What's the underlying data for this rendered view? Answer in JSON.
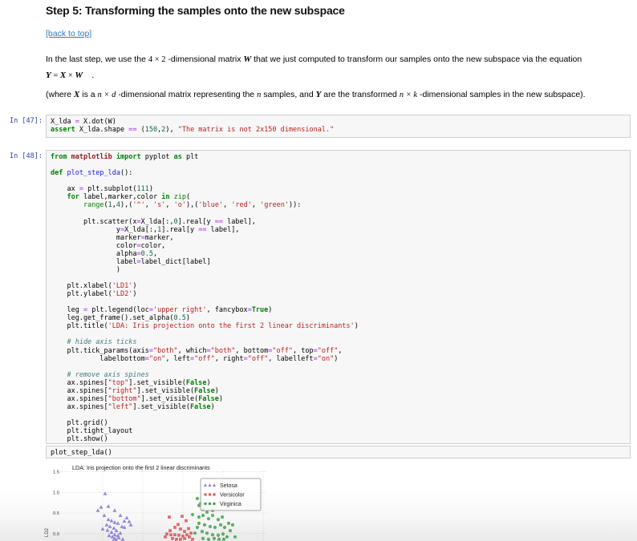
{
  "page": {
    "heading": "Step 5: Transforming the samples onto the new subspace",
    "back_link": "[back to top]",
    "para1": [
      {
        "t": "t",
        "v": "In the last step, we use the "
      },
      {
        "t": "m",
        "v": "4 × 2"
      },
      {
        "t": "t",
        "v": " -dimensional matrix "
      },
      {
        "t": "mb",
        "v": "W"
      },
      {
        "t": "t",
        "v": " that we just computed to transform our samples onto the new subspace via the equation"
      }
    ],
    "equation": [
      {
        "t": "mb",
        "v": "Y"
      },
      {
        "t": "m",
        "v": " = "
      },
      {
        "t": "mb",
        "v": "X"
      },
      {
        "t": "m",
        "v": " × "
      },
      {
        "t": "mb",
        "v": "W"
      },
      {
        "t": "t",
        "v": "  ."
      }
    ],
    "para2": [
      {
        "t": "t",
        "v": "(where "
      },
      {
        "t": "mb",
        "v": "X"
      },
      {
        "t": "t",
        "v": " is a "
      },
      {
        "t": "mi",
        "v": "n × d"
      },
      {
        "t": "t",
        "v": " -dimensional matrix representing the "
      },
      {
        "t": "mi",
        "v": "n"
      },
      {
        "t": "t",
        "v": " samples, and "
      },
      {
        "t": "mb",
        "v": "Y"
      },
      {
        "t": "t",
        "v": " are the transformed "
      },
      {
        "t": "mi",
        "v": "n × k"
      },
      {
        "t": "t",
        "v": " -dimensional samples in the new subspace)."
      }
    ]
  },
  "cells": [
    {
      "prompt": "In [47]:",
      "lines": [
        [
          [
            "p",
            "X_lda "
          ],
          [
            "o",
            "="
          ],
          [
            "p",
            " X.dot(W)"
          ]
        ],
        [
          [
            "k",
            "assert"
          ],
          [
            "p",
            " X_lda.shape "
          ],
          [
            "o",
            "=="
          ],
          [
            "p",
            " ("
          ],
          [
            "m",
            "150"
          ],
          [
            "p",
            ","
          ],
          [
            "m",
            "2"
          ],
          [
            "p",
            "), "
          ],
          [
            "s",
            "\"The matrix is not 2x150 dimensional.\""
          ]
        ]
      ]
    },
    {
      "prompt": "In [48]:",
      "lines": [
        [
          [
            "k",
            "from"
          ],
          [
            "nn",
            " matplotlib "
          ],
          [
            "k",
            "import"
          ],
          [
            "p",
            " pyplot "
          ],
          [
            "k",
            "as"
          ],
          [
            "p",
            " plt"
          ]
        ],
        [],
        [
          [
            "k",
            "def"
          ],
          [
            "fn",
            " plot_step_lda"
          ],
          [
            "p",
            "():"
          ]
        ],
        [],
        [
          [
            "p",
            "    ax "
          ],
          [
            "o",
            "="
          ],
          [
            "p",
            " plt.subplot("
          ],
          [
            "m",
            "111"
          ],
          [
            "p",
            ")"
          ]
        ],
        [
          [
            "p",
            "    "
          ],
          [
            "k",
            "for"
          ],
          [
            "p",
            " label,marker,color "
          ],
          [
            "k",
            "in"
          ],
          [
            "p",
            " "
          ],
          [
            "b",
            "zip"
          ],
          [
            "p",
            "("
          ]
        ],
        [
          [
            "p",
            "        "
          ],
          [
            "b",
            "range"
          ],
          [
            "p",
            "("
          ],
          [
            "m",
            "1"
          ],
          [
            "p",
            ","
          ],
          [
            "m",
            "4"
          ],
          [
            "p",
            "),("
          ],
          [
            "s",
            "'^'"
          ],
          [
            "p",
            ", "
          ],
          [
            "s",
            "'s'"
          ],
          [
            "p",
            ", "
          ],
          [
            "s",
            "'o'"
          ],
          [
            "p",
            "),("
          ],
          [
            "s",
            "'blue'"
          ],
          [
            "p",
            ", "
          ],
          [
            "s",
            "'red'"
          ],
          [
            "p",
            ", "
          ],
          [
            "s",
            "'green'"
          ],
          [
            "p",
            ")):"
          ]
        ],
        [],
        [
          [
            "p",
            "        plt.scatter(x"
          ],
          [
            "o",
            "="
          ],
          [
            "p",
            "X_lda[:,"
          ],
          [
            "m",
            "0"
          ],
          [
            "p",
            "].real[y "
          ],
          [
            "o",
            "=="
          ],
          [
            "p",
            " label],"
          ]
        ],
        [
          [
            "p",
            "                y"
          ],
          [
            "o",
            "="
          ],
          [
            "p",
            "X_lda[:,"
          ],
          [
            "m",
            "1"
          ],
          [
            "p",
            "].real[y "
          ],
          [
            "o",
            "=="
          ],
          [
            "p",
            " label],"
          ]
        ],
        [
          [
            "p",
            "                marker"
          ],
          [
            "o",
            "="
          ],
          [
            "p",
            "marker,"
          ]
        ],
        [
          [
            "p",
            "                color"
          ],
          [
            "o",
            "="
          ],
          [
            "p",
            "color,"
          ]
        ],
        [
          [
            "p",
            "                alpha"
          ],
          [
            "o",
            "="
          ],
          [
            "m",
            "0.5"
          ],
          [
            "p",
            ","
          ]
        ],
        [
          [
            "p",
            "                label"
          ],
          [
            "o",
            "="
          ],
          [
            "p",
            "label_dict[label]"
          ]
        ],
        [
          [
            "p",
            "                )"
          ]
        ],
        [],
        [
          [
            "p",
            "    plt.xlabel("
          ],
          [
            "s",
            "'LD1'"
          ],
          [
            "p",
            ")"
          ]
        ],
        [
          [
            "p",
            "    plt.ylabel("
          ],
          [
            "s",
            "'LD2'"
          ],
          [
            "p",
            ")"
          ]
        ],
        [],
        [
          [
            "p",
            "    leg "
          ],
          [
            "o",
            "="
          ],
          [
            "p",
            " plt.legend(loc"
          ],
          [
            "o",
            "="
          ],
          [
            "s",
            "'upper right'"
          ],
          [
            "p",
            ", fancybox"
          ],
          [
            "o",
            "="
          ],
          [
            "kc",
            "True"
          ],
          [
            "p",
            ")"
          ]
        ],
        [
          [
            "p",
            "    leg.get_frame().set_alpha("
          ],
          [
            "m",
            "0.5"
          ],
          [
            "p",
            ")"
          ]
        ],
        [
          [
            "p",
            "    plt.title("
          ],
          [
            "s",
            "'LDA: Iris projection onto the first 2 linear discriminants'"
          ],
          [
            "p",
            ")"
          ]
        ],
        [],
        [
          [
            "c",
            "    # hide axis ticks"
          ]
        ],
        [
          [
            "p",
            "    plt.tick_params(axis"
          ],
          [
            "o",
            "="
          ],
          [
            "s",
            "\"both\""
          ],
          [
            "p",
            ", which"
          ],
          [
            "o",
            "="
          ],
          [
            "s",
            "\"both\""
          ],
          [
            "p",
            ", bottom"
          ],
          [
            "o",
            "="
          ],
          [
            "s",
            "\"off\""
          ],
          [
            "p",
            ", top"
          ],
          [
            "o",
            "="
          ],
          [
            "s",
            "\"off\""
          ],
          [
            "p",
            ","
          ]
        ],
        [
          [
            "p",
            "            labelbottom"
          ],
          [
            "o",
            "="
          ],
          [
            "s",
            "\"on\""
          ],
          [
            "p",
            ", left"
          ],
          [
            "o",
            "="
          ],
          [
            "s",
            "\"off\""
          ],
          [
            "p",
            ", right"
          ],
          [
            "o",
            "="
          ],
          [
            "s",
            "\"off\""
          ],
          [
            "p",
            ", labelleft"
          ],
          [
            "o",
            "="
          ],
          [
            "s",
            "\"on\""
          ],
          [
            "p",
            ")"
          ]
        ],
        [],
        [
          [
            "c",
            "    # remove axis spines"
          ]
        ],
        [
          [
            "p",
            "    ax.spines["
          ],
          [
            "s",
            "\"top\""
          ],
          [
            "p",
            "].set_visible("
          ],
          [
            "kc",
            "False"
          ],
          [
            "p",
            ")"
          ]
        ],
        [
          [
            "p",
            "    ax.spines["
          ],
          [
            "s",
            "\"right\""
          ],
          [
            "p",
            "].set_visible("
          ],
          [
            "kc",
            "False"
          ],
          [
            "p",
            ")"
          ]
        ],
        [
          [
            "p",
            "    ax.spines["
          ],
          [
            "s",
            "\"bottom\""
          ],
          [
            "p",
            "].set_visible("
          ],
          [
            "kc",
            "False"
          ],
          [
            "p",
            ")"
          ]
        ],
        [
          [
            "p",
            "    ax.spines["
          ],
          [
            "s",
            "\"left\""
          ],
          [
            "p",
            "].set_visible("
          ],
          [
            "kc",
            "False"
          ],
          [
            "p",
            ")"
          ]
        ],
        [],
        [
          [
            "p",
            "    plt.grid()"
          ]
        ],
        [
          [
            "p",
            "    plt.tight_layout"
          ]
        ],
        [
          [
            "p",
            "    plt.show()"
          ]
        ]
      ]
    },
    {
      "prompt": "",
      "lines": [
        [
          [
            "p",
            "plot_step_lda()"
          ]
        ]
      ]
    }
  ],
  "chart_data": {
    "type": "scatter",
    "title": "LDA: Iris projection onto the first 2 linear discriminants",
    "ylabel": "LD2",
    "yticks": [
      1.5,
      1.0,
      0.5,
      0.0
    ],
    "xgrid": [
      -2,
      -1,
      0,
      1,
      2
    ],
    "ylim_visible": [
      -0.2,
      1.55
    ],
    "grid": true,
    "legend_position": "upper right",
    "note": "figure is cut off at the bottom of the screenshot; x tick labels not visible",
    "series": [
      {
        "name": "Setosa",
        "marker": "triangle",
        "color": "#7A64DC",
        "points": [
          [
            -1.94,
            0.97
          ],
          [
            -2.04,
            0.64
          ],
          [
            -1.86,
            0.66
          ],
          [
            -2.12,
            0.56
          ],
          [
            -1.7,
            0.56
          ],
          [
            -1.56,
            0.44
          ],
          [
            -1.96,
            0.44
          ],
          [
            -1.86,
            0.34
          ],
          [
            -1.78,
            0.31
          ],
          [
            -1.7,
            0.27
          ],
          [
            -1.62,
            0.25
          ],
          [
            -1.52,
            0.17
          ],
          [
            -1.46,
            0.15
          ],
          [
            -1.9,
            0.21
          ],
          [
            -1.82,
            0.17
          ],
          [
            -1.72,
            0.13
          ],
          [
            -1.66,
            0.07
          ],
          [
            -1.78,
            0.03
          ],
          [
            -1.7,
            -0.03
          ],
          [
            -1.62,
            -0.05
          ],
          [
            -1.76,
            -0.08
          ],
          [
            -1.7,
            -0.12
          ],
          [
            -1.66,
            -0.16
          ],
          [
            -1.4,
            0.38
          ],
          [
            -1.34,
            0.29
          ],
          [
            -2.0,
            0.11
          ],
          [
            -1.56,
            0.01
          ],
          [
            -1.84,
            -0.05
          ],
          [
            -1.6,
            -0.1
          ],
          [
            -1.74,
            -0.18
          ],
          [
            -1.5,
            -0.14
          ],
          [
            -1.88,
            0.08
          ],
          [
            -1.46,
            0.3
          ],
          [
            -1.3,
            0.21
          ]
        ]
      },
      {
        "name": "Versicolor",
        "marker": "square",
        "color": "#E04343",
        "points": [
          [
            -0.34,
            0.4
          ],
          [
            -0.02,
            0.42
          ],
          [
            0.08,
            0.31
          ],
          [
            -0.2,
            0.15
          ],
          [
            -0.06,
            0.11
          ],
          [
            0.04,
            0.05
          ],
          [
            -0.4,
            -0.01
          ],
          [
            -0.3,
            -0.03
          ],
          [
            -0.2,
            -0.03
          ],
          [
            -0.1,
            -0.04
          ],
          [
            0.0,
            -0.06
          ],
          [
            0.1,
            -0.03
          ],
          [
            0.2,
            0.01
          ],
          [
            -0.26,
            -0.12
          ],
          [
            -0.16,
            -0.14
          ],
          [
            -0.06,
            -0.14
          ],
          [
            0.04,
            -0.12
          ],
          [
            -0.32,
            0.07
          ],
          [
            0.16,
            -0.08
          ],
          [
            -0.44,
            -0.08
          ],
          [
            0.24,
            -0.14
          ],
          [
            -0.12,
            0.22
          ],
          [
            0.14,
            0.12
          ]
        ]
      },
      {
        "name": "Virginica",
        "marker": "circle",
        "color": "#2E9E38",
        "points": [
          [
            0.24,
            0.46
          ],
          [
            0.4,
            0.4
          ],
          [
            0.5,
            0.44
          ],
          [
            0.64,
            0.36
          ],
          [
            0.74,
            0.44
          ],
          [
            0.88,
            0.34
          ],
          [
            0.98,
            0.4
          ],
          [
            0.4,
            0.25
          ],
          [
            0.54,
            0.21
          ],
          [
            0.68,
            0.17
          ],
          [
            0.8,
            0.15
          ],
          [
            0.94,
            0.21
          ],
          [
            1.04,
            0.15
          ],
          [
            1.14,
            0.25
          ],
          [
            0.48,
            0.05
          ],
          [
            0.6,
            0.01
          ],
          [
            0.74,
            -0.03
          ],
          [
            0.88,
            -0.04
          ],
          [
            1.0,
            -0.01
          ],
          [
            0.5,
            -0.12
          ],
          [
            0.64,
            -0.14
          ],
          [
            0.78,
            -0.12
          ],
          [
            0.9,
            -0.14
          ],
          [
            1.1,
            -0.08
          ],
          [
            1.3,
            -0.08
          ],
          [
            1.02,
            -0.14
          ],
          [
            0.4,
            0.68
          ],
          [
            0.5,
            0.58
          ],
          [
            0.6,
            0.52
          ],
          [
            0.74,
            0.56
          ],
          [
            0.44,
            0.73
          ],
          [
            0.36,
            0.15
          ],
          [
            0.3,
            0.01
          ],
          [
            1.18,
            0.07
          ],
          [
            1.24,
            0.21
          ],
          [
            0.36,
            0.85
          ]
        ]
      }
    ]
  }
}
